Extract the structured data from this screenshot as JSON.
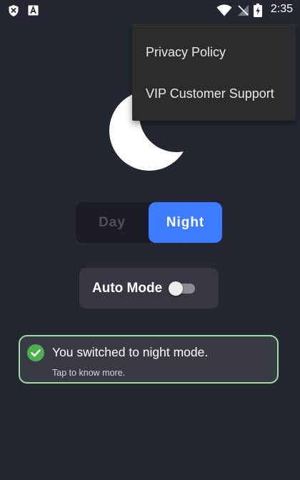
{
  "status_bar": {
    "time": "2:35",
    "icons": [
      "shield-x-icon",
      "text-a-icon",
      "wifi-icon",
      "no-signal-icon",
      "battery-charging-icon"
    ]
  },
  "menu": {
    "items": [
      {
        "label": "Privacy Policy"
      },
      {
        "label": "VIP Customer Support"
      }
    ]
  },
  "mode_toggle": {
    "day_label": "Day",
    "night_label": "Night",
    "selected": "Night"
  },
  "auto_mode": {
    "label": "Auto Mode",
    "enabled": false
  },
  "toast": {
    "icon": "check-circle-icon",
    "title": "You switched to night mode.",
    "subtitle": "Tap to know more."
  },
  "colors": {
    "background": "#242632",
    "accent": "#3d7bff",
    "toast_border": "#9fdc9f",
    "success": "#4caf50"
  }
}
